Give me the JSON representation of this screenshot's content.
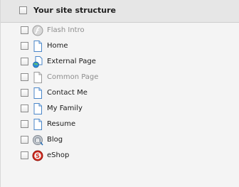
{
  "header": {
    "title": "Your site structure"
  },
  "items": [
    {
      "label": "Flash Intro",
      "icon": "flash-icon",
      "dimmed": true
    },
    {
      "label": "Home",
      "icon": "page-icon",
      "dimmed": false
    },
    {
      "label": "External Page",
      "icon": "external-page-icon",
      "dimmed": false
    },
    {
      "label": "Common Page",
      "icon": "common-page-icon",
      "dimmed": true
    },
    {
      "label": "Contact Me",
      "icon": "page-icon",
      "dimmed": false
    },
    {
      "label": "My Family",
      "icon": "page-icon",
      "dimmed": false
    },
    {
      "label": "Resume",
      "icon": "page-icon",
      "dimmed": false
    },
    {
      "label": "Blog",
      "icon": "blog-icon",
      "dimmed": false
    },
    {
      "label": "eShop",
      "icon": "eshop-icon",
      "dimmed": false
    }
  ]
}
